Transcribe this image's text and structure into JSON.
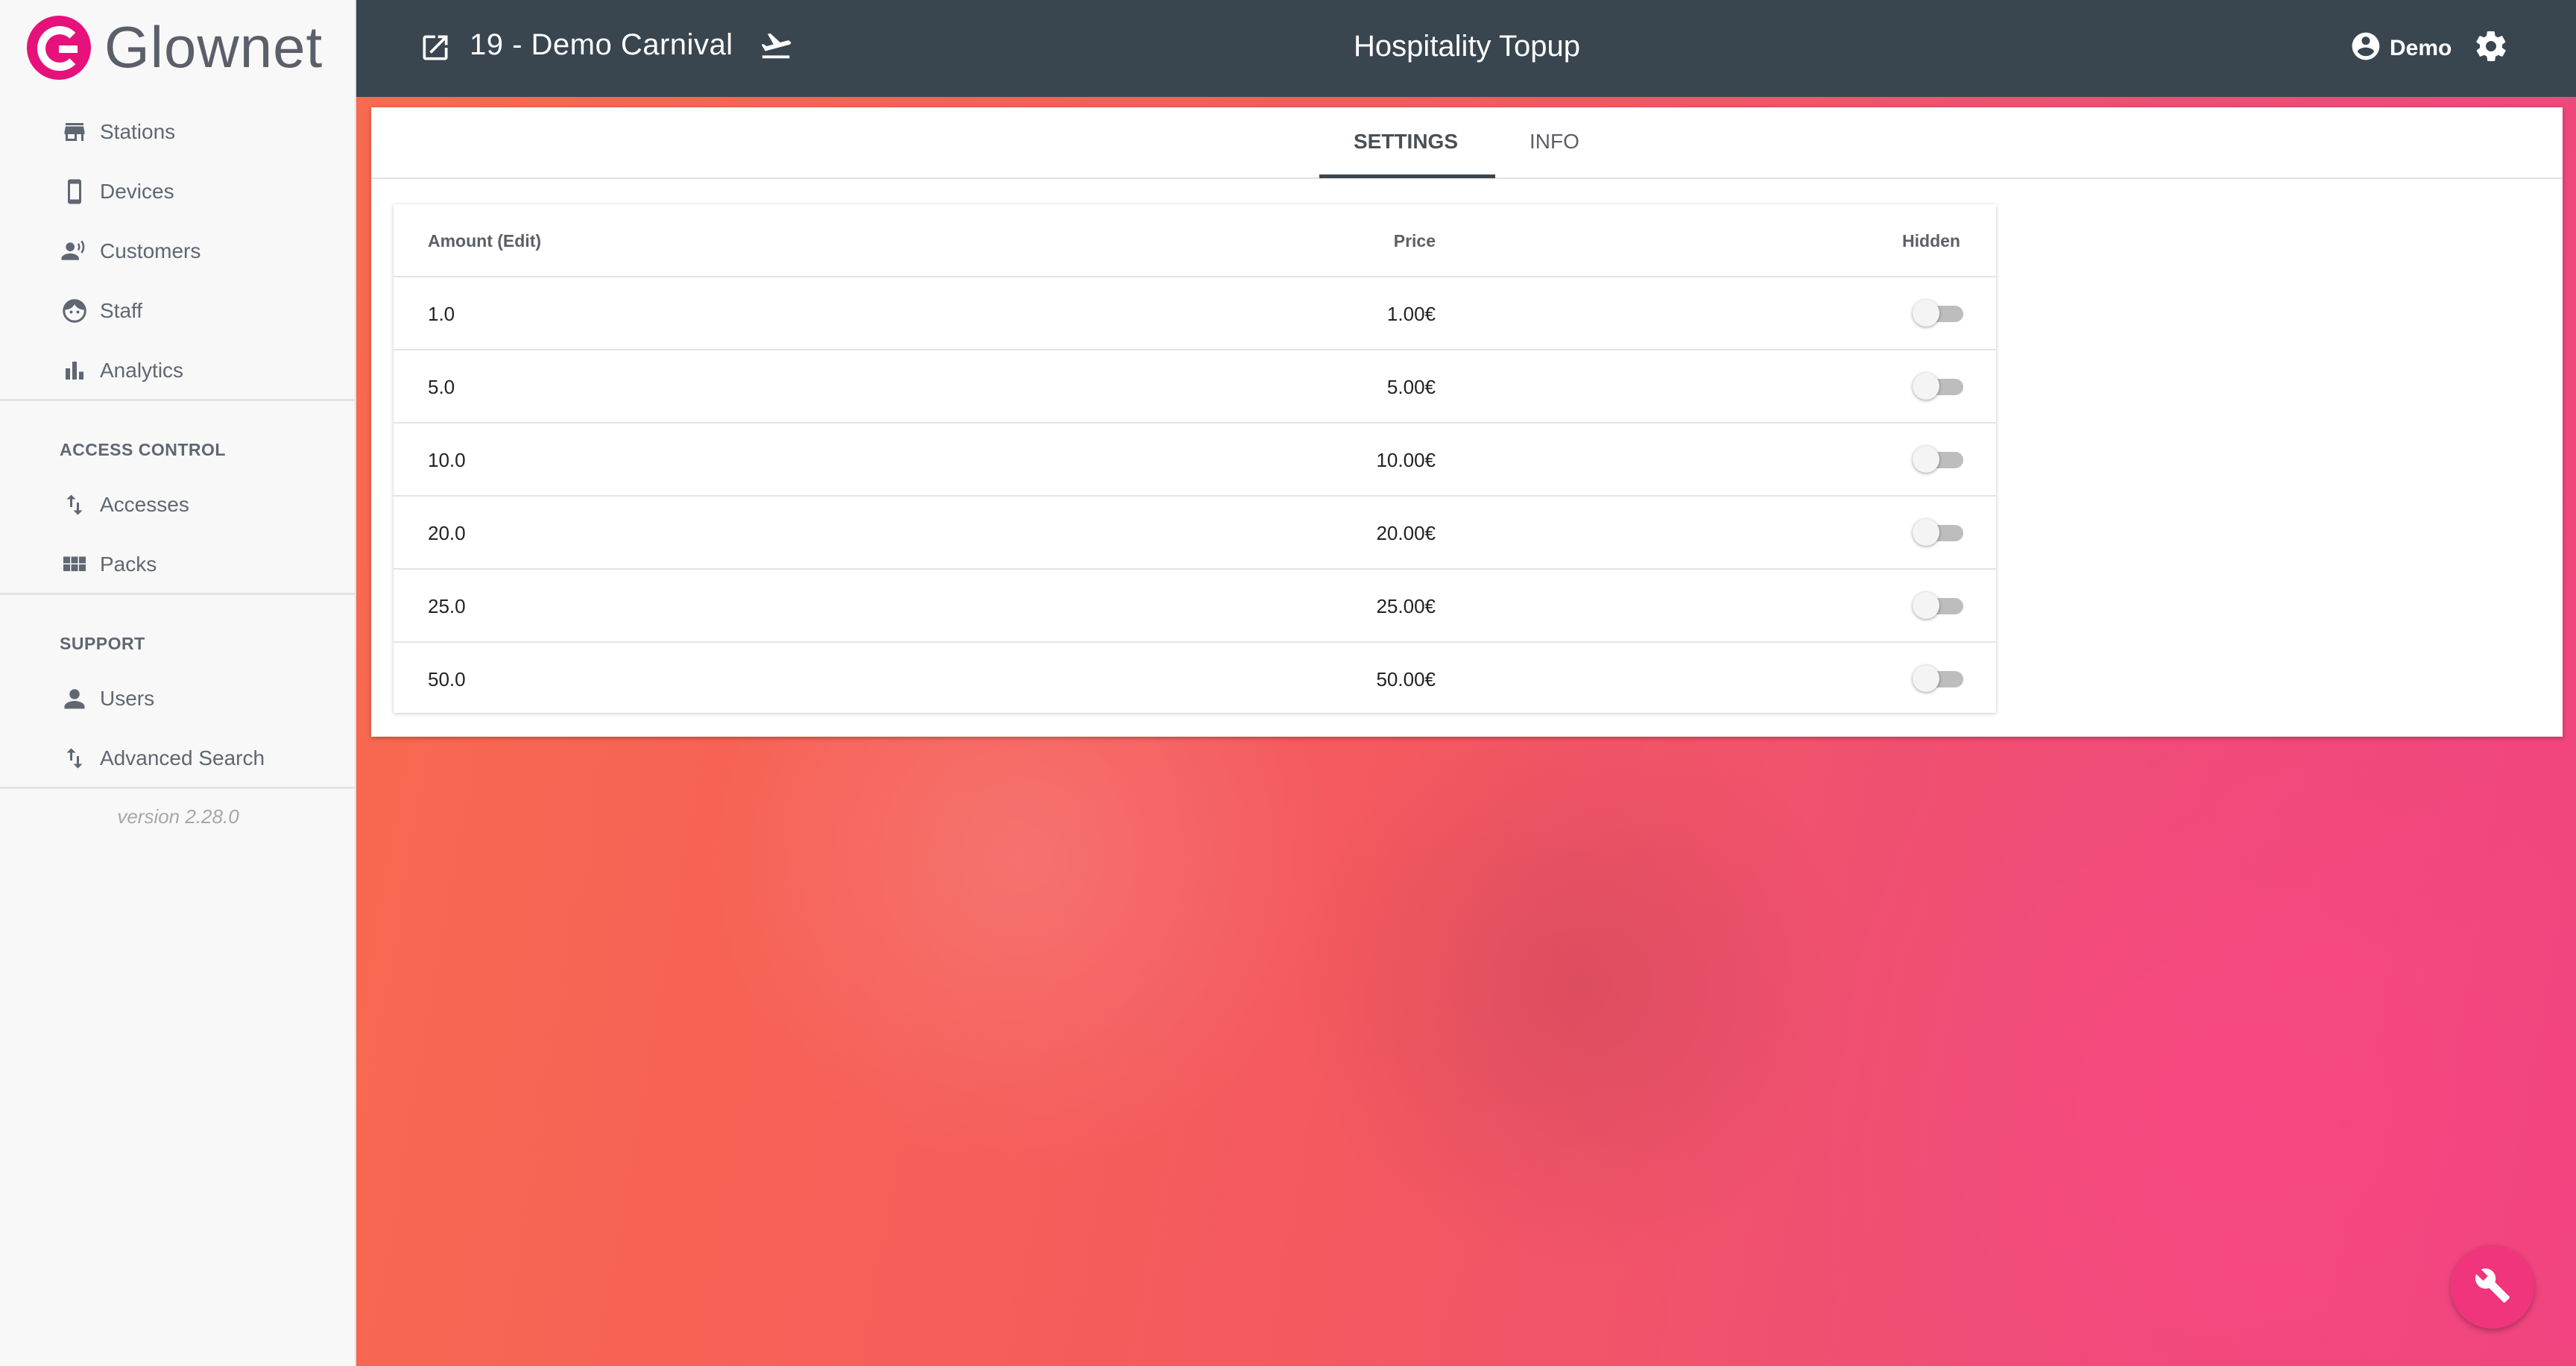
{
  "brand": {
    "name": "Glownet",
    "color": "#e6117a"
  },
  "sidebar": {
    "items": [
      {
        "label": "Stations",
        "icon": "store-icon"
      },
      {
        "label": "Devices",
        "icon": "smartphone-icon"
      },
      {
        "label": "Customers",
        "icon": "customers-icon"
      },
      {
        "label": "Staff",
        "icon": "face-icon"
      },
      {
        "label": "Analytics",
        "icon": "bar-chart-icon"
      }
    ],
    "access_control": {
      "title": "ACCESS CONTROL",
      "items": [
        {
          "label": "Accesses",
          "icon": "swap-vertical-icon"
        },
        {
          "label": "Packs",
          "icon": "grid-icon"
        }
      ]
    },
    "support": {
      "title": "SUPPORT",
      "items": [
        {
          "label": "Users",
          "icon": "person-icon"
        },
        {
          "label": "Advanced Search",
          "icon": "swap-vertical-icon"
        }
      ]
    },
    "version": "version 2.28.0"
  },
  "header": {
    "event_title": "19 - Demo Carnival",
    "page_title": "Hospitality Topup",
    "user_name": "Demo",
    "bg_color": "#394650"
  },
  "tabs": [
    {
      "label": "SETTINGS",
      "active": true
    },
    {
      "label": "INFO",
      "active": false
    }
  ],
  "table": {
    "headers": {
      "amount": "Amount (Edit)",
      "price": "Price",
      "hidden": "Hidden"
    },
    "rows": [
      {
        "amount": "1.0",
        "price": "1.00€",
        "hidden": false
      },
      {
        "amount": "5.0",
        "price": "5.00€",
        "hidden": false
      },
      {
        "amount": "10.0",
        "price": "10.00€",
        "hidden": false
      },
      {
        "amount": "20.0",
        "price": "20.00€",
        "hidden": false
      },
      {
        "amount": "25.0",
        "price": "25.00€",
        "hidden": false
      },
      {
        "amount": "50.0",
        "price": "50.00€",
        "hidden": false
      }
    ]
  },
  "fab": {
    "icon": "wrench-icon",
    "color": "#f0357d"
  }
}
